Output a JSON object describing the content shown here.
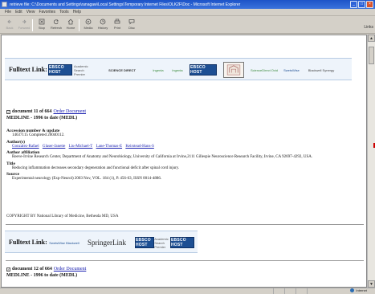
{
  "window": {
    "title": "retrieve file: C:\\Documents and Settings\\ranagaw\\Local Settings\\Temporary Internet Files\\OLK2F\\Doc - Microsoft Internet Explorer",
    "btn_min": "_",
    "btn_max": "□",
    "btn_close": "×"
  },
  "menu": [
    "File",
    "Edit",
    "View",
    "Favorites",
    "Tools",
    "Help"
  ],
  "toolbar": {
    "back": "Back",
    "forward": "Forward",
    "stop": "Stop",
    "refresh": "Refresh",
    "home": "Home",
    "media": "Media",
    "history": "History",
    "print": "Print",
    "discuss": "Disc",
    "links": "Links"
  },
  "fulltext_top": {
    "label": "Fulltext Link:",
    "logos": [
      "EBSCO HOST",
      "Academic Search Premier",
      "SCIENCE DIRECT",
      "Ingenta",
      "Ingenta",
      "EBSCO HOST",
      "ScienceDirect Ovid",
      "SwetsWise",
      "Blackwell Synergy"
    ]
  },
  "doc1": {
    "checkbox": "✓",
    "doc_text": "document 11 of 664",
    "order_link": "Order Document",
    "database": "MEDLINE - 1996 to date (MEDL)",
    "fields": [
      {
        "label": "Accession number & update",
        "value": "14637115 Completed 20040112."
      },
      {
        "label": "Author(s)",
        "authors": [
          "Gonzalez-Rafael",
          "Glaser-Janette",
          "Liu-Michael-T",
          "Lane-Thomas-E",
          "Keirstead-Hans-S"
        ]
      },
      {
        "label": "Author affiliation",
        "value": "Reeve-Irvine Research Center, Department of Anatomy and Neurobiology, University of California at Irvine,2111 Gillespie Neuroscience Research Facility, Irvine, CA 92697-4292, USA."
      },
      {
        "label": "Title",
        "value": "Reducing inflammation decreases secondary degeneration and functional deficit after spinal cord injury."
      },
      {
        "label": "Source",
        "value": "Experimental neurology (Exp-Neurol) 2003 Nov, VOL. 184 (1), P. 456-63, ISSN 0014-4886."
      }
    ],
    "copyright": "COPYRIGHT BY National Library of Medicine, Bethesda MD, USA"
  },
  "fulltext_bottom": {
    "label": "Fulltext Link:",
    "logos": [
      "SwetsWise Blackwell",
      "SpringerLink",
      "EBSCO HOST",
      "Academic Search Premier",
      "EBSCO HOST"
    ]
  },
  "doc2": {
    "checkbox": "✓",
    "doc_text": "document 12 of 664",
    "order_link": "Order Document",
    "database": "MEDLINE - 1996 to date (MEDL)"
  },
  "statusbar": {
    "zone": "Internet"
  },
  "colors": {
    "titlebar": "#1d54c8",
    "link": "#1a20b0",
    "ebsco": "#1d4f93"
  }
}
